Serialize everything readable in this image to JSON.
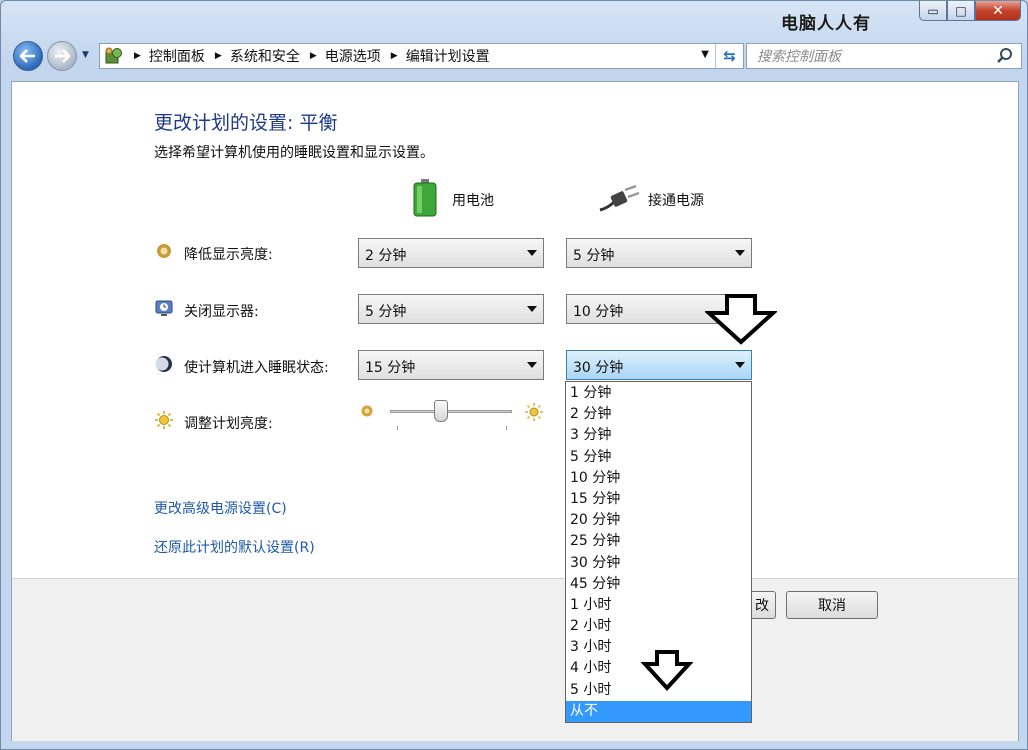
{
  "watermark": "电脑人人有",
  "window_buttons": {
    "minimize": "▭",
    "maximize": "□",
    "close": "✕"
  },
  "nav": {
    "breadcrumbs": [
      "控制面板",
      "系统和安全",
      "电源选项",
      "编辑计划设置"
    ],
    "search_placeholder": "搜索控制面板"
  },
  "page": {
    "title": "更改计划的设置: 平衡",
    "subtitle": "选择希望计算机使用的睡眠设置和显示设置。",
    "col_battery": "用电池",
    "col_plugged": "接通电源"
  },
  "settings": [
    {
      "label": "降低显示亮度:",
      "battery": "2 分钟",
      "plugged": "5 分钟"
    },
    {
      "label": "关闭显示器:",
      "battery": "5 分钟",
      "plugged": "10 分钟"
    },
    {
      "label": "使计算机进入睡眠状态:",
      "battery": "15 分钟",
      "plugged": "30 分钟"
    }
  ],
  "brightness": {
    "label": "调整计划亮度:",
    "level": 0.42
  },
  "links": {
    "advanced": "更改高级电源设置(C)",
    "restore": "还原此计划的默认设置(R)"
  },
  "buttons": {
    "save_partial": "改",
    "cancel": "取消"
  },
  "dropdown_options": [
    "1 分钟",
    "2 分钟",
    "3 分钟",
    "5 分钟",
    "10 分钟",
    "15 分钟",
    "20 分钟",
    "25 分钟",
    "30 分钟",
    "45 分钟",
    "1 小时",
    "2 小时",
    "3 小时",
    "4 小时",
    "5 小时",
    "从不"
  ],
  "dropdown_highlighted": "从不",
  "colors": {
    "title": "#1e3a8a",
    "link": "#1e5aa8",
    "highlight": "#3399ff"
  }
}
